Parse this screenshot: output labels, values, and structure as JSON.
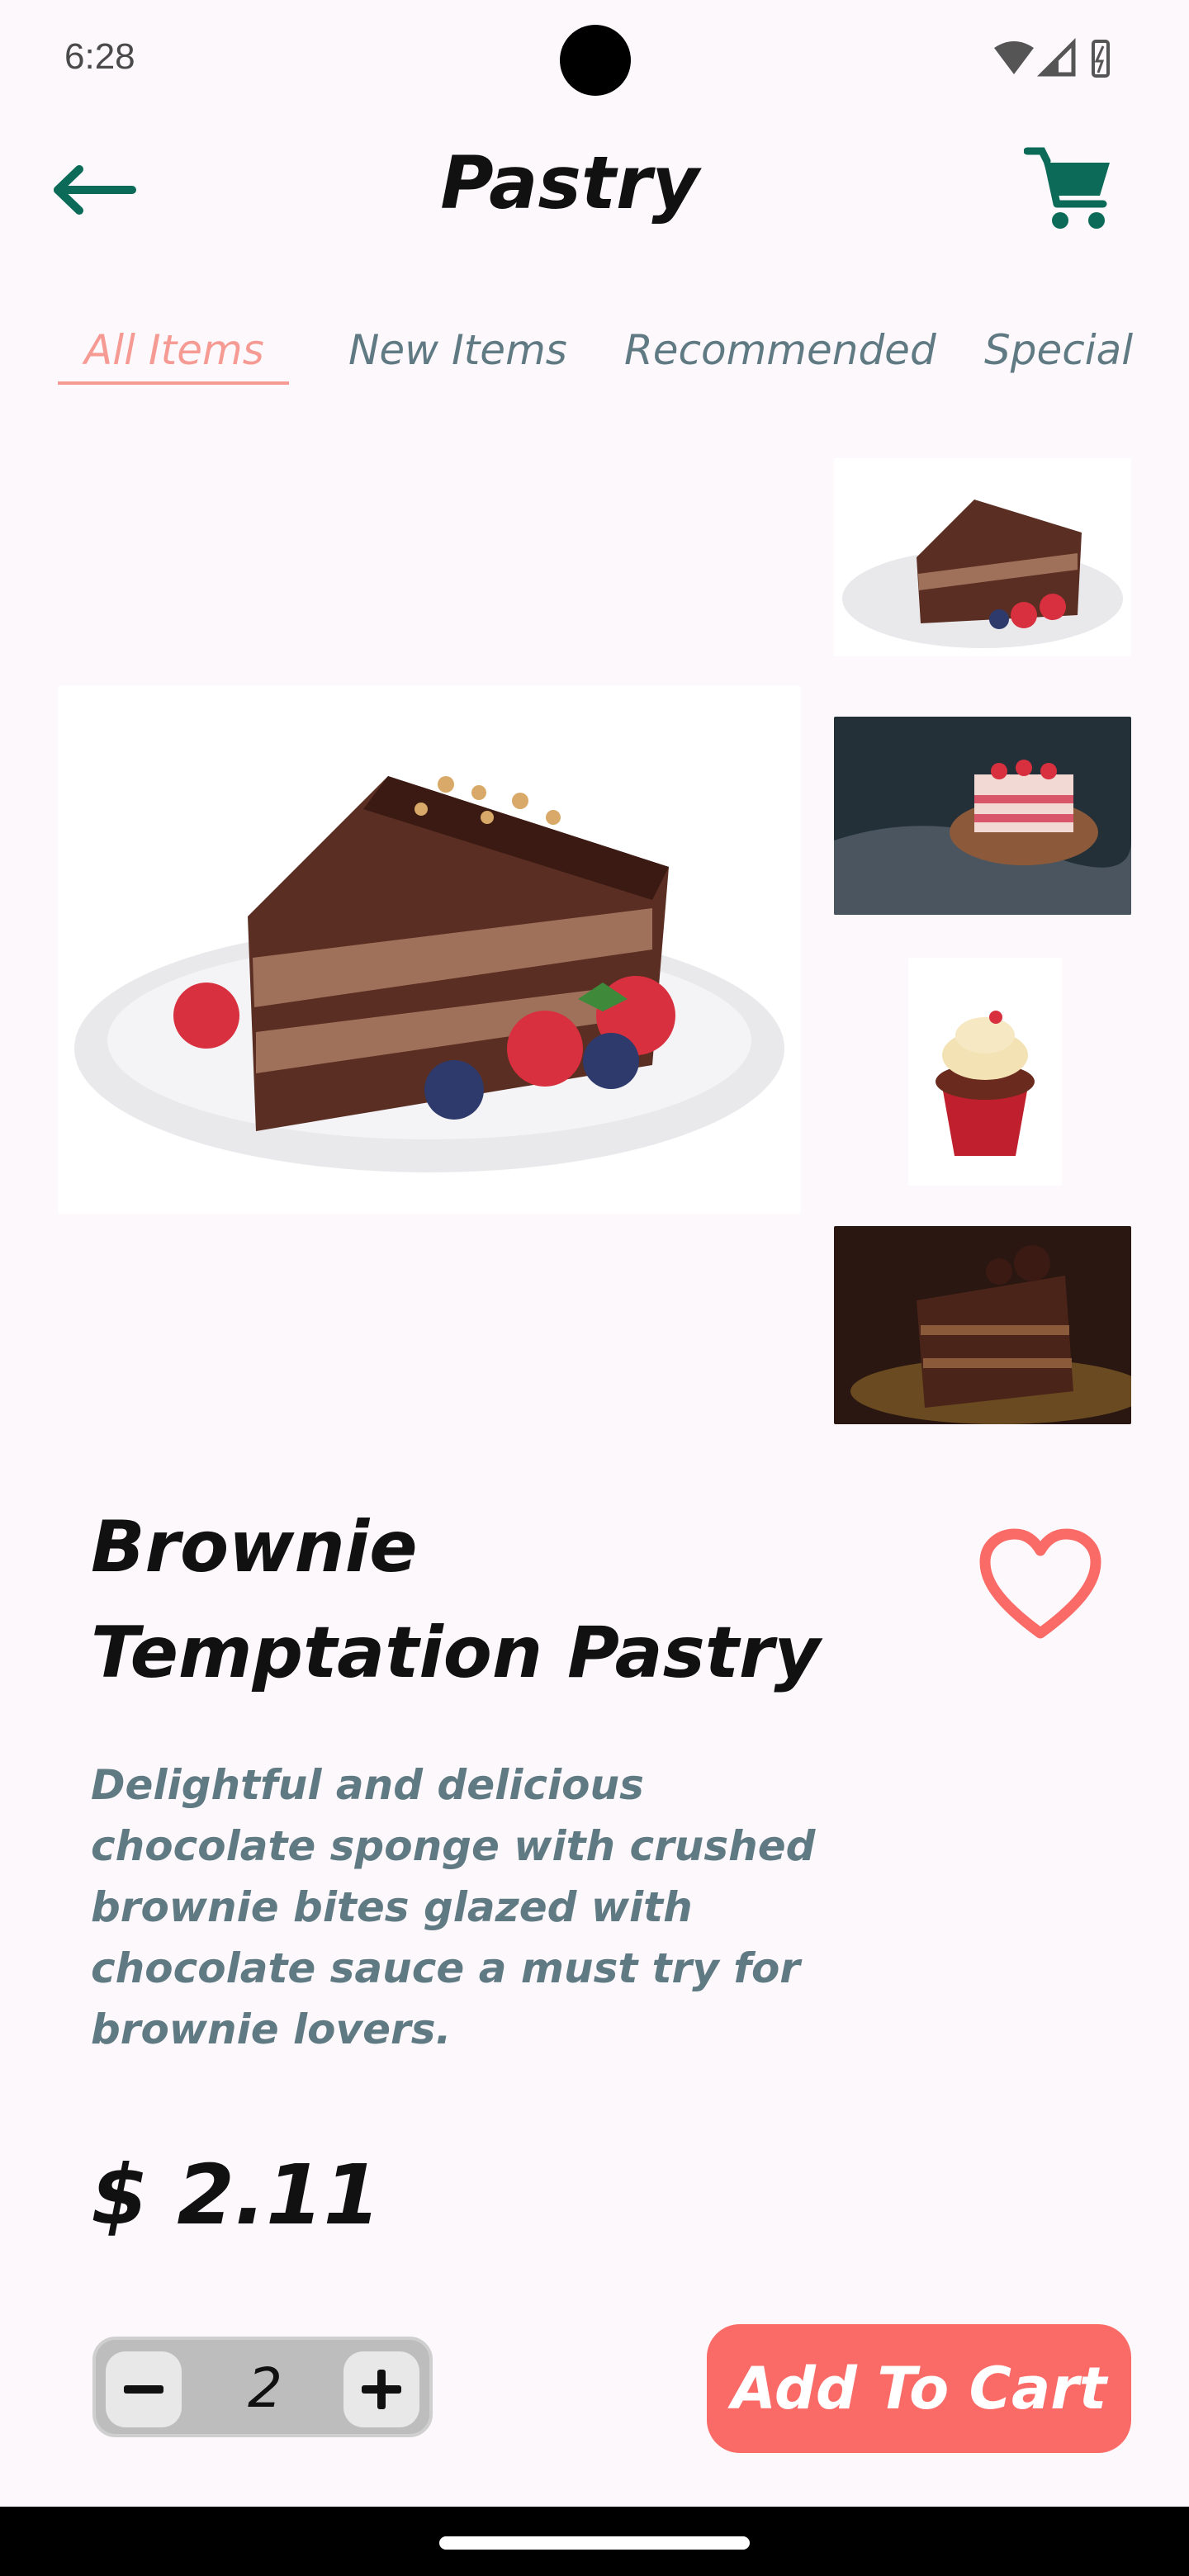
{
  "status_bar": {
    "time": "6:28"
  },
  "header": {
    "title": "Pastry",
    "back_icon": "arrow-left-icon",
    "cart_icon": "shopping-cart-icon"
  },
  "tabs": [
    {
      "label": "All Items",
      "active": true
    },
    {
      "label": "New Items",
      "active": false
    },
    {
      "label": "Recommended",
      "active": false
    },
    {
      "label": "Special",
      "active": false
    }
  ],
  "gallery": {
    "main_image": "chocolate-cake-slice-with-berries",
    "thumbnails": [
      "chocolate-cake-slice-with-berries",
      "strawberry-layer-cake-on-board",
      "cupcake-with-cream",
      "chocolate-pastry-slice-dark"
    ]
  },
  "product": {
    "name": "Brownie Temptation Pastry",
    "description": "Delightful and delicious chocolate sponge with crushed brownie bites glazed with chocolate sauce a must try for brownie lovers.",
    "price": "$ 2.11",
    "favorite_icon": "heart-outline-icon"
  },
  "quantity": {
    "value": "2",
    "minus_icon": "minus-icon",
    "plus_icon": "plus-icon"
  },
  "actions": {
    "add_to_cart": "Add To Cart"
  },
  "colors": {
    "accent": "#fa6a66",
    "tab_active": "#f59b94",
    "tab_inactive": "#607a84",
    "header_icons": "#0b6b58"
  }
}
